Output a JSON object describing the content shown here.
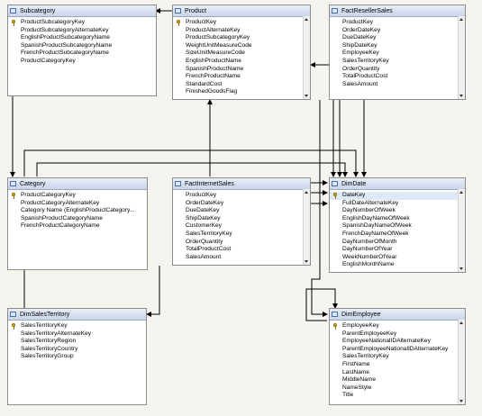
{
  "tables": {
    "subcategory": {
      "title": "Subcategory",
      "columns": [
        "ProductSubcategoryKey",
        "ProductSubcategoryAlternateKey",
        "EnglishProductSubcategoryName",
        "SpanishProductSubcategoryName",
        "FrenchProductSubcategoryName",
        "ProductCategoryKey"
      ]
    },
    "product": {
      "title": "Product",
      "columns": [
        "ProductKey",
        "ProductAlternateKey",
        "ProductSubcategoryKey",
        "WeightUnitMeasureCode",
        "SizeUnitMeasureCode",
        "EnglishProductName",
        "SpanishProductName",
        "FrenchProductName",
        "StandardCost",
        "FinishedGoodsFlag"
      ]
    },
    "fact_reseller_sales": {
      "title": "FactResellerSales",
      "columns": [
        "ProductKey",
        "OrderDateKey",
        "DueDateKey",
        "ShipDateKey",
        "EmployeeKey",
        "SalesTerritoryKey",
        "OrderQuantity",
        "TotalProductCost",
        "SalesAmount"
      ]
    },
    "category": {
      "title": "Category",
      "columns": [
        "ProductCategoryKey",
        "ProductCategoryAlternateKey",
        "Category Name (EnglishProductCategory...",
        "SpanishProductCategoryName",
        "FrenchProductCategoryName"
      ]
    },
    "fact_internet_sales": {
      "title": "FactInternetSales",
      "columns": [
        "ProductKey",
        "OrderDateKey",
        "DueDateKey",
        "ShipDateKey",
        "CustomerKey",
        "SalesTerritoryKey",
        "OrderQuantity",
        "TotalProductCost",
        "SalesAmount"
      ]
    },
    "dim_date": {
      "title": "DimDate",
      "columns": [
        "DateKey",
        "FullDateAlternateKey",
        "DayNumberOfWeek",
        "EnglishDayNameOfWeek",
        "SpanishDayNameOfWeek",
        "FrenchDayNameOfWeek",
        "DayNumberOfMonth",
        "DayNumberOfYear",
        "WeekNumberOfYear",
        "EnglishMonthName"
      ]
    },
    "dim_sales_territory": {
      "title": "DimSalesTerritory",
      "columns": [
        "SalesTerritoryKey",
        "SalesTerritoryAlternateKey",
        "SalesTerritoryRegion",
        "SalesTerritoryCountry",
        "SalesTerritoryGroup"
      ]
    },
    "dim_employee": {
      "title": "DimEmployee",
      "columns": [
        "EmployeeKey",
        "ParentEmployeeKey",
        "EmployeeNationalIDAlternateKey",
        "ParentEmployeeNationalIDAlternateKey",
        "SalesTerritoryKey",
        "FirstName",
        "LastName",
        "MiddleName",
        "NameStyle",
        "Title"
      ]
    }
  },
  "colors": {
    "line": "#000000",
    "header_start": "#e9eef7",
    "header_end": "#c9d5ea",
    "background": "#f5f4ee",
    "key": "#e8b820"
  }
}
